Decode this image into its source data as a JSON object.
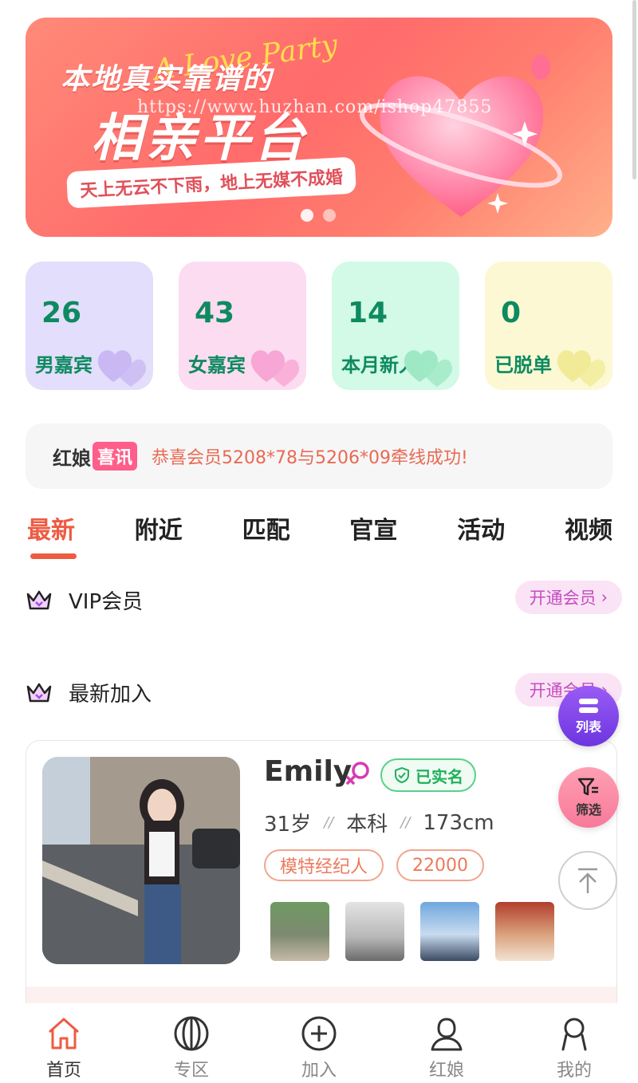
{
  "banner": {
    "script_text": "A Love Party",
    "line1": "本地真实靠谱的",
    "line2": "相亲平台",
    "watermark": "https://www.huzhan.com/ishop47855",
    "slogan": "天上无云不下雨，地上无媒不成婚"
  },
  "stats": [
    {
      "value": "26",
      "label": "男嘉宾",
      "bg": "#e3defb",
      "heart": "#c9b8f3"
    },
    {
      "value": "43",
      "label": "女嘉宾",
      "bg": "#fcdcf0",
      "heart": "#f7a6d5"
    },
    {
      "value": "14",
      "label": "本月新人",
      "bg": "#d2fae6",
      "heart": "#9ee8c6"
    },
    {
      "value": "0",
      "label": "已脱单",
      "bg": "#fbf8d3",
      "heart": "#f1eb98"
    }
  ],
  "notice": {
    "brand": "红娘",
    "brand_tag": "喜讯",
    "message": "恭喜会员5208*78与5206*09牵线成功!"
  },
  "tabs": [
    "最新",
    "附近",
    "匹配",
    "官宣",
    "活动",
    "视频"
  ],
  "sections": {
    "vip": {
      "title": "VIP会员",
      "button": "开通会员"
    },
    "newest": {
      "title": "最新加入",
      "button": "开通会员"
    }
  },
  "profile": {
    "name": "Emily",
    "verified": "已实名",
    "age": "31岁",
    "education": "本科",
    "height": "173cm",
    "tags": [
      "模特经纪人",
      "22000"
    ]
  },
  "fab": {
    "list": "列表",
    "filter": "筛选"
  },
  "bottom_nav": [
    {
      "label": "首页",
      "icon": "home-icon"
    },
    {
      "label": "专区",
      "icon": "zone-icon"
    },
    {
      "label": "加入",
      "icon": "add-icon"
    },
    {
      "label": "红娘",
      "icon": "matchmaker-icon"
    },
    {
      "label": "我的",
      "icon": "user-icon"
    }
  ],
  "colors": {
    "accent": "#ee5b43",
    "stat_text": "#0e8a61",
    "vip_button_bg": "#fbe3f6",
    "vip_button_text": "#c44dbf"
  }
}
